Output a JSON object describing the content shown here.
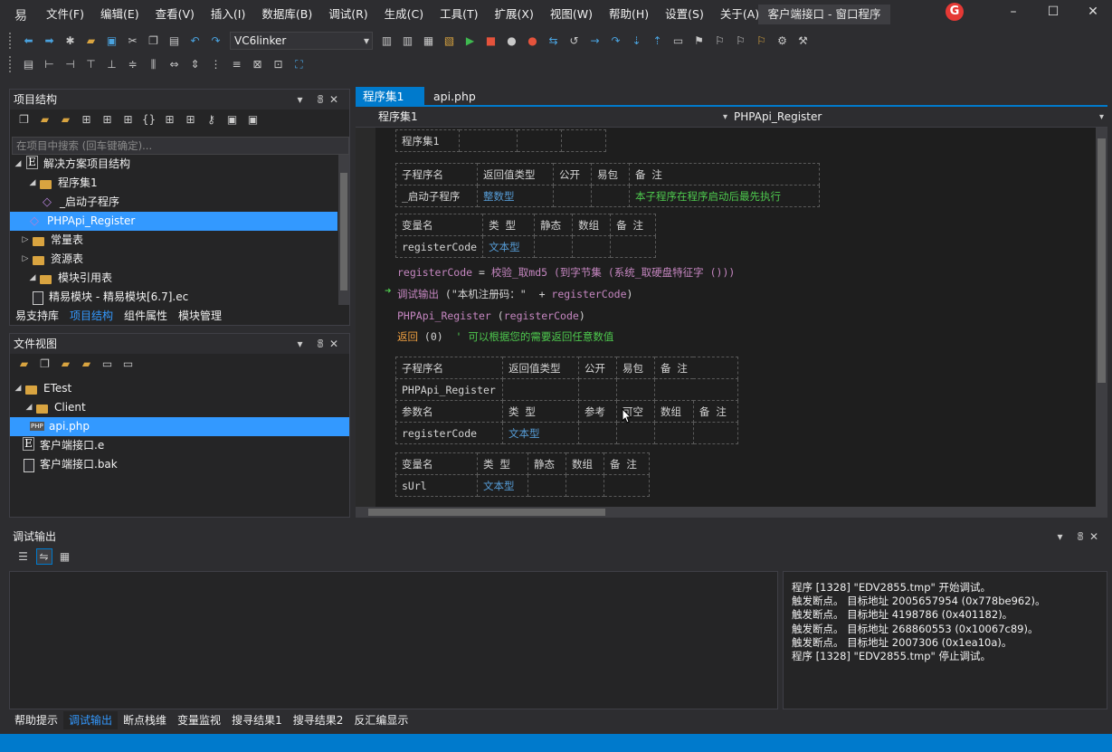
{
  "app": {
    "logo_icon": "yi-logo-icon",
    "window_title": "客户端接口 - 窗口程序"
  },
  "menu": [
    "文件(F)",
    "编辑(E)",
    "查看(V)",
    "插入(I)",
    "数据库(B)",
    "调试(R)",
    "生成(C)",
    "工具(T)",
    "扩展(X)",
    "视图(W)",
    "帮助(H)",
    "设置(S)",
    "关于(A)"
  ],
  "toolbar": {
    "compiler": "VC6linker"
  },
  "project_panel": {
    "title": "项目结构",
    "search_placeholder": "在项目中搜索 (回车键确定)...",
    "tree": [
      {
        "label": "解决方案项目结构",
        "icon": "e-icon"
      },
      {
        "label": "程序集1",
        "icon": "folder-icon"
      },
      {
        "label": "_启动子程序",
        "icon": "cube-icon"
      },
      {
        "label": "PHPApi_Register",
        "icon": "cube-icon",
        "selected": true
      },
      {
        "label": "常量表",
        "icon": "folder-icon"
      },
      {
        "label": "资源表",
        "icon": "folder-icon"
      },
      {
        "label": "模块引用表",
        "icon": "folder-icon"
      },
      {
        "label": "精易模块 - 精易模块[6.7].ec",
        "icon": "document-icon"
      }
    ],
    "tabs": [
      "易支持库",
      "项目结构",
      "组件属性",
      "模块管理"
    ],
    "active_tab": "项目结构"
  },
  "file_panel": {
    "title": "文件视图",
    "tree": [
      {
        "label": "ETest",
        "icon": "folder-icon"
      },
      {
        "label": "Client",
        "icon": "folder-icon"
      },
      {
        "label": "api.php",
        "icon": "php-icon",
        "selected": true
      },
      {
        "label": "客户端接口.e",
        "icon": "e-icon"
      },
      {
        "label": "客户端接口.bak",
        "icon": "document-icon"
      }
    ]
  },
  "editor": {
    "tabs": [
      {
        "label": "程序集1",
        "active": true
      },
      {
        "label": "api.php",
        "active": false
      }
    ],
    "nav_left": "程序集1",
    "nav_right": "PHPApi_Register",
    "assembly_table": {
      "name": "程序集1"
    },
    "sub1": {
      "headers": [
        "子程序名",
        "返回值类型",
        "公开",
        "易包",
        "备 注"
      ],
      "row": [
        "_启动子程序",
        "整数型",
        "",
        "",
        "本子程序在程序启动后最先执行"
      ]
    },
    "vars1": {
      "headers": [
        "变量名",
        "类 型",
        "静态",
        "数组",
        "备 注"
      ],
      "row": [
        "registerCode",
        "文本型",
        "",
        "",
        ""
      ]
    },
    "code": {
      "l1": {
        "var": "registerCode",
        "op": " = ",
        "fn": "校验_取md5 (到字节集 (系统_取硬盘特征字 ()))"
      },
      "l2": {
        "fn": "调试输出",
        "a": " (",
        "str": "\"本机注册码：\"",
        "b": "  + ",
        "var": "registerCode",
        "c": ")"
      },
      "l3": {
        "fn": "PHPApi_Register",
        "a": " (",
        "var": "registerCode",
        "b": ")"
      },
      "l4": {
        "kw": "返回",
        "a": " (0)  ",
        "cm": "' 可以根据您的需要返回任意数值"
      }
    },
    "sub2": {
      "headers": [
        "子程序名",
        "返回值类型",
        "公开",
        "易包",
        "备 注"
      ],
      "row": [
        "PHPApi_Register",
        "",
        "",
        "",
        ""
      ],
      "param_headers": [
        "参数名",
        "类 型",
        "参考",
        "可空",
        "数组",
        "备 注"
      ],
      "param_row": [
        "registerCode",
        "文本型",
        "",
        "",
        "",
        ""
      ]
    },
    "vars2": {
      "headers": [
        "变量名",
        "类 型",
        "静态",
        "数组",
        "备 注"
      ],
      "rows": [
        [
          "sUrl",
          "文本型",
          "",
          "",
          ""
        ]
      ]
    }
  },
  "output_panel": {
    "title": "调试输出",
    "log": [
      "程序 [1328] \"EDV2855.tmp\" 开始调试。",
      "触发断点。 目标地址 2005657954 (0x778be962)。",
      "触发断点。 目标地址 4198786 (0x401182)。",
      "触发断点。 目标地址 268860553 (0x10067c89)。",
      "触发断点。 目标地址 2007306 (0x1ea10a)。",
      "程序 [1328] \"EDV2855.tmp\" 停止调试。"
    ],
    "tabs": [
      "帮助提示",
      "调试输出",
      "断点栈维",
      "变量监视",
      "搜寻结果1",
      "搜寻结果2",
      "反汇编显示"
    ],
    "active_tab": "调试输出"
  },
  "colors": {
    "accent": "#007acc",
    "selection": "#3399ff",
    "background": "#2d2d30"
  }
}
